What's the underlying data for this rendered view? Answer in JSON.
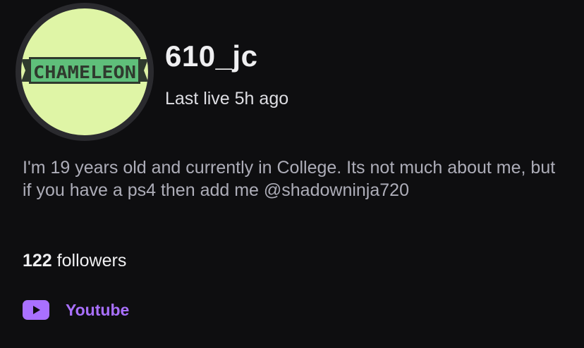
{
  "profile": {
    "avatar_logo_text": "CHAMELEON",
    "username": "610_jc",
    "last_live": "Last live 5h ago",
    "bio": "I'm 19 years old and currently in College. Its not much about me, but if you have a ps4 then add me @shadowninja720",
    "followers_count": "122",
    "followers_label": "followers"
  },
  "links": [
    {
      "label": "Youtube",
      "icon": "youtube-icon"
    }
  ],
  "colors": {
    "background": "#0e0e10",
    "avatar_bg": "#dff5a6",
    "logo_green": "#5fbf7a",
    "logo_dark": "#2f3a2e",
    "link_accent": "#a970ff",
    "text_primary": "#efeff1",
    "text_secondary": "#adadb8"
  }
}
